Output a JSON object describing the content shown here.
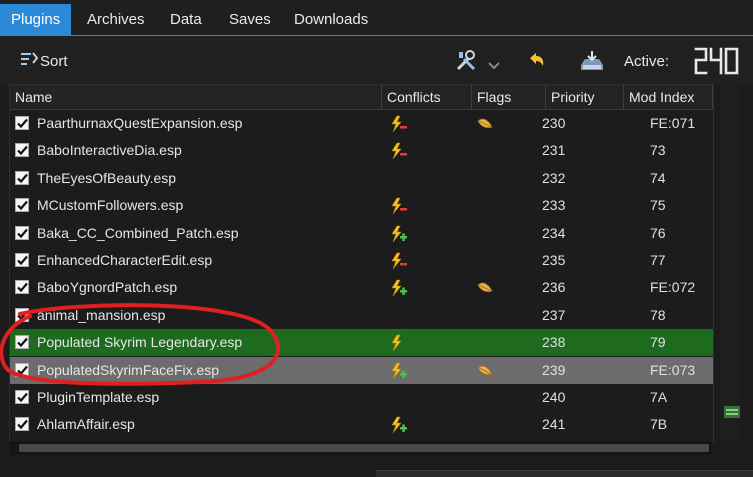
{
  "tabs": [
    {
      "label": "Plugins",
      "active": true
    },
    {
      "label": "Archives",
      "active": false
    },
    {
      "label": "Data",
      "active": false
    },
    {
      "label": "Saves",
      "active": false
    },
    {
      "label": "Downloads",
      "active": false
    }
  ],
  "toolbar": {
    "sort_label": "Sort",
    "tools_icon": "wrench-screwdriver-icon",
    "dropdown_icon": "chevron-down-icon",
    "undo_icon": "undo-arrow-icon",
    "restore_icon": "restore-backup-icon",
    "active_label": "Active:",
    "active_count": "240"
  },
  "table": {
    "columns": [
      "Name",
      "Conflicts",
      "Flags",
      "Priority",
      "Mod Index"
    ],
    "rows": [
      {
        "name": "PaarthurnaxQuestExpansion.esp",
        "checked": true,
        "conflict": "overwritten",
        "flag": true,
        "priority": "230",
        "mod_index": "FE:071",
        "state": "normal"
      },
      {
        "name": "BaboInteractiveDia.esp",
        "checked": true,
        "conflict": "overwritten",
        "flag": false,
        "priority": "231",
        "mod_index": "73",
        "state": "normal"
      },
      {
        "name": "TheEyesOfBeauty.esp",
        "checked": true,
        "conflict": "none",
        "flag": false,
        "priority": "232",
        "mod_index": "74",
        "state": "normal"
      },
      {
        "name": "MCustomFollowers.esp",
        "checked": true,
        "conflict": "overwritten",
        "flag": false,
        "priority": "233",
        "mod_index": "75",
        "state": "normal"
      },
      {
        "name": "Baka_CC_Combined_Patch.esp",
        "checked": true,
        "conflict": "overwrites",
        "flag": false,
        "priority": "234",
        "mod_index": "76",
        "state": "normal"
      },
      {
        "name": "EnhancedCharacterEdit.esp",
        "checked": true,
        "conflict": "overwritten",
        "flag": false,
        "priority": "235",
        "mod_index": "77",
        "state": "normal"
      },
      {
        "name": "BaboYgnordPatch.esp",
        "checked": true,
        "conflict": "overwrites",
        "flag": true,
        "priority": "236",
        "mod_index": "FE:072",
        "state": "normal"
      },
      {
        "name": "animal_mansion.esp",
        "checked": true,
        "conflict": "none",
        "flag": false,
        "priority": "237",
        "mod_index": "78",
        "state": "normal"
      },
      {
        "name": "Populated Skyrim Legendary.esp",
        "checked": true,
        "conflict": "plain",
        "flag": false,
        "priority": "238",
        "mod_index": "79",
        "state": "highlight-green"
      },
      {
        "name": "PopulatedSkyrimFaceFix.esp",
        "checked": true,
        "conflict": "overwrites",
        "flag": true,
        "priority": "239",
        "mod_index": "FE:073",
        "state": "selected"
      },
      {
        "name": "PluginTemplate.esp",
        "checked": true,
        "conflict": "none",
        "flag": false,
        "priority": "240",
        "mod_index": "7A",
        "state": "normal"
      },
      {
        "name": "AhlamAffair.esp",
        "checked": true,
        "conflict": "overwrites",
        "flag": false,
        "priority": "241",
        "mod_index": "7B",
        "state": "normal"
      }
    ]
  },
  "colors": {
    "accent": "#2b8ad8",
    "highlight_green": "#1e6b1f",
    "selected_grey": "#6c6c6c",
    "annotation_red": "#e02020"
  }
}
